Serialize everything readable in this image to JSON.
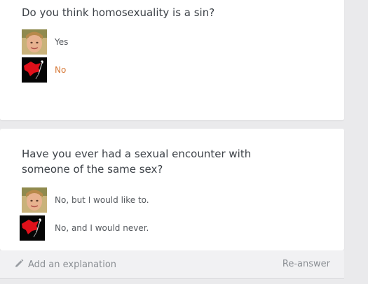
{
  "questions": [
    {
      "text": "Do you think homosexuality is a sin?",
      "answers": [
        {
          "avatar": "user-avatar-photo",
          "text": "Yes"
        },
        {
          "avatar": "match-avatar-red",
          "text": "No"
        }
      ]
    },
    {
      "text": "Have you ever had a sexual encounter with someone of the same sex?",
      "answers": [
        {
          "avatar": "user-avatar-photo",
          "text": "No, but I would like to."
        },
        {
          "avatar": "match-avatar-red",
          "text": "No, and I would never."
        }
      ]
    }
  ],
  "footer": {
    "explain_label": "Add an explanation",
    "explain_icon": "pencil-icon",
    "reanswer_label": "Re-answer"
  },
  "colors": {
    "accent": "#d77b3a",
    "text": "#3e4349",
    "muted": "#8a8e93",
    "background": "#eaeaec"
  }
}
